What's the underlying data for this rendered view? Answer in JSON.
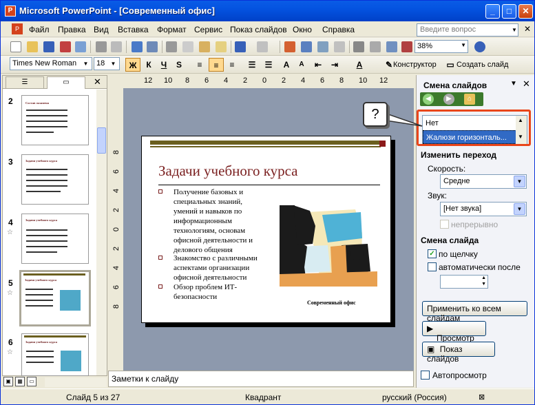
{
  "window": {
    "title": "Microsoft PowerPoint - [Современный офис]"
  },
  "menu": {
    "items": [
      "Файл",
      "Правка",
      "Вид",
      "Вставка",
      "Формат",
      "Сервис",
      "Показ слайдов",
      "Окно",
      "Справка"
    ],
    "ask_placeholder": "Введите вопрос"
  },
  "toolbar": {
    "zoom": "38%",
    "font": "Times New Roman",
    "size": "18",
    "bold": "Ж",
    "italic": "К",
    "underline": "Ч",
    "shadow": "S",
    "designer": "Конструктор",
    "new_slide": "Создать слайд"
  },
  "slides_pane": {
    "thumbnails": [
      {
        "num": "2",
        "title": "Состав экзамена"
      },
      {
        "num": "3",
        "title": "Задачи учебного курса"
      },
      {
        "num": "4",
        "title": "Задачи учебного курса"
      },
      {
        "num": "5",
        "title": "Задачи учебного курса"
      },
      {
        "num": "6",
        "title": "Задачи учебного курса"
      }
    ]
  },
  "ruler": {
    "h": [
      "12",
      "10",
      "8",
      "6",
      "4",
      "2",
      "0",
      "2",
      "4",
      "6",
      "8",
      "10",
      "12"
    ],
    "v": [
      "8",
      "6",
      "4",
      "2",
      "0",
      "2",
      "4",
      "6",
      "8"
    ]
  },
  "slide": {
    "title": "Задачи учебного курса",
    "bullets": [
      "Получение базовых и специальных знаний, умений и навыков по информационным технологиям, основам офисной деятельности и делового общения",
      "Знакомство с различными аспектами организации офисной деятельности",
      "Обзор проблем ИТ-безопасности"
    ],
    "caption": "Современный офис"
  },
  "notes": {
    "placeholder": "Заметки к слайду"
  },
  "task_pane": {
    "title": "Смена слайдов",
    "transitions": [
      "Нет",
      "Жалюзи горизонталь..."
    ],
    "callout": "?",
    "modify_heading": "Изменить переход",
    "speed_label": "Скорость:",
    "speed_value": "Средне",
    "sound_label": "Звук:",
    "sound_value": "[Нет звука]",
    "loop_label": "непрерывно",
    "advance_heading": "Смена слайда",
    "on_click_label": "по щелчку",
    "auto_label": "автоматически после",
    "apply_all": "Применить ко всем слайдам",
    "preview": "Просмотр",
    "slideshow": "Показ слайдов",
    "autopreview": "Автопросмотр"
  },
  "status": {
    "slide": "Слайд 5 из 27",
    "design": "Квадрант",
    "lang": "русский (Россия)"
  },
  "colors": {
    "accent": "#316ac5",
    "highlight": "#e9451a",
    "title_blue": "#0453e0",
    "slide_title": "#7a1f1f"
  }
}
